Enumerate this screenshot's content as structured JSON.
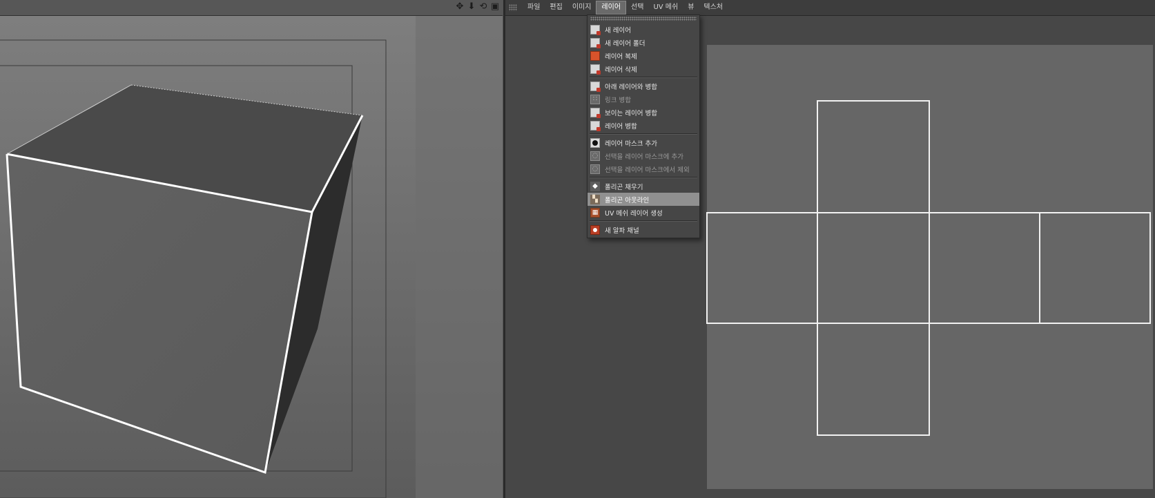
{
  "viewport": {
    "tool_icons": [
      "move-icon",
      "down-arrow-icon",
      "rotate-icon",
      "layout-icon"
    ],
    "tool_glyphs": [
      "✥",
      "⬇",
      "⟲",
      "▣"
    ]
  },
  "uv_editor": {
    "menubar": {
      "items": [
        {
          "label": "파일"
        },
        {
          "label": "편집"
        },
        {
          "label": "이미지"
        },
        {
          "label": "레이어"
        },
        {
          "label": "선택"
        },
        {
          "label": "UV 메쉬"
        },
        {
          "label": "뷰"
        },
        {
          "label": "텍스처"
        }
      ],
      "active_item": "레이어"
    }
  },
  "layer_menu": {
    "items": [
      {
        "label": "새 레이어",
        "icon": "new-layer-icon",
        "enabled": true
      },
      {
        "label": "새 레이어 폴더",
        "icon": "new-layer-folder-icon",
        "enabled": true
      },
      {
        "label": "레이어 복제",
        "icon": "duplicate-layer-icon",
        "enabled": true
      },
      {
        "label": "레이어 삭제",
        "icon": "delete-layer-icon",
        "enabled": true
      },
      {
        "label": "아래 레이어와 병합",
        "icon": "merge-down-icon",
        "enabled": true
      },
      {
        "label": "링크 병합",
        "icon": "merge-linked-icon",
        "enabled": false
      },
      {
        "label": "보이는 레이어 병합",
        "icon": "merge-visible-icon",
        "enabled": true
      },
      {
        "label": "레이어 병합",
        "icon": "merge-layers-icon",
        "enabled": true
      },
      {
        "label": "레이어 마스크 추가",
        "icon": "add-layer-mask-icon",
        "enabled": true
      },
      {
        "label": "선택을 레이어 마스크에 추가",
        "icon": "add-selection-to-mask-icon",
        "enabled": false
      },
      {
        "label": "선택을 레이어 마스크에서 제외",
        "icon": "subtract-selection-from-mask-icon",
        "enabled": false
      },
      {
        "label": "폴리곤 채우기",
        "icon": "fill-polygons-icon",
        "enabled": true
      },
      {
        "label": "폴리곤 아웃라인",
        "icon": "outline-polygons-icon",
        "enabled": true,
        "highlighted": true
      },
      {
        "label": "UV 메쉬 레이어 생성",
        "icon": "create-uv-mesh-layer-icon",
        "enabled": true
      },
      {
        "label": "새 알파 채널",
        "icon": "new-alpha-channel-icon",
        "enabled": true
      }
    ]
  }
}
